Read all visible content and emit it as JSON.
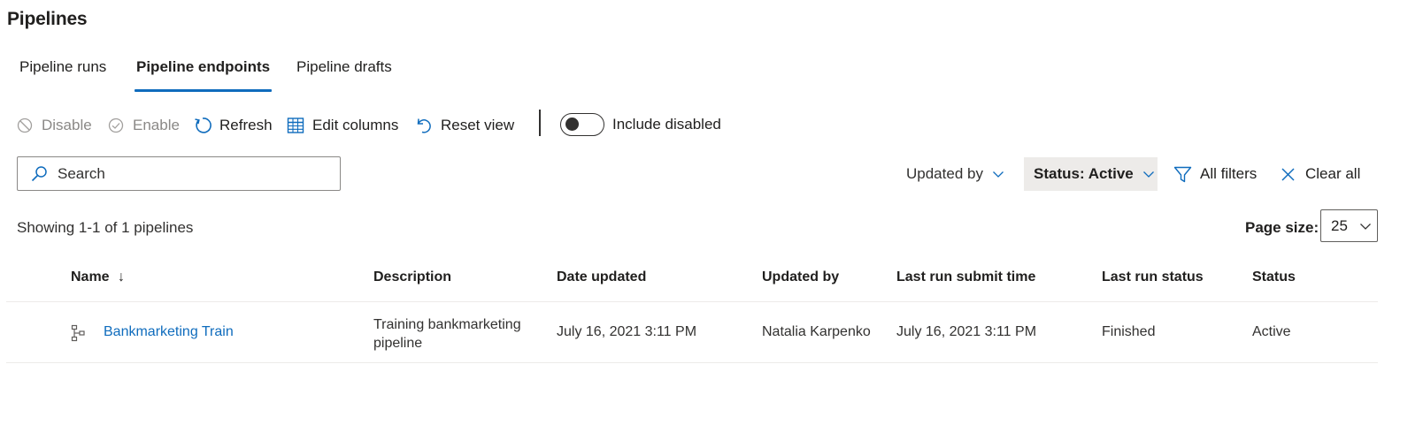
{
  "page": {
    "title": "Pipelines"
  },
  "tabs": [
    {
      "label": "Pipeline runs",
      "active": false
    },
    {
      "label": "Pipeline endpoints",
      "active": true
    },
    {
      "label": "Pipeline drafts",
      "active": false
    }
  ],
  "toolbar": {
    "disable_label": "Disable",
    "enable_label": "Enable",
    "refresh_label": "Refresh",
    "edit_columns_label": "Edit columns",
    "reset_view_label": "Reset view",
    "include_disabled_label": "Include disabled",
    "include_disabled_on": false
  },
  "search": {
    "placeholder": "Search",
    "value": ""
  },
  "filters": {
    "updated_by_label": "Updated by",
    "status_label": "Status: Active",
    "all_filters_label": "All filters",
    "clear_all_label": "Clear all"
  },
  "summary": {
    "showing_text": "Showing 1-1 of 1 pipelines"
  },
  "pagination": {
    "page_size_label": "Page size:",
    "page_size_value": "25"
  },
  "table": {
    "columns": {
      "name": "Name",
      "sort_indicator": "↓",
      "description": "Description",
      "date_updated": "Date updated",
      "updated_by": "Updated by",
      "last_run_submit_time": "Last run submit time",
      "last_run_status": "Last run status",
      "status": "Status"
    },
    "rows": [
      {
        "name": "Bankmarketing Train",
        "description_line1": "Training bankmarketing",
        "description_line2": "pipeline",
        "date_updated": "July 16, 2021 3:11 PM",
        "updated_by": "Natalia Karpenko",
        "last_run_submit_time": "July 16, 2021 3:11 PM",
        "last_run_status": "Finished",
        "status": "Active"
      }
    ]
  },
  "colors": {
    "accent": "#0f6cbd",
    "text": "#201f1e",
    "disabled": "#8a8886",
    "pill_bg": "#edebe9"
  },
  "icons": {
    "disable": "disable-circle-icon",
    "enable": "checkmark-circle-icon",
    "refresh": "refresh-icon",
    "edit_columns": "table-columns-icon",
    "reset_view": "undo-icon",
    "search": "search-icon",
    "chevron": "chevron-down-icon",
    "filter": "filter-funnel-icon",
    "clear": "close-icon",
    "pipeline": "pipeline-icon"
  }
}
